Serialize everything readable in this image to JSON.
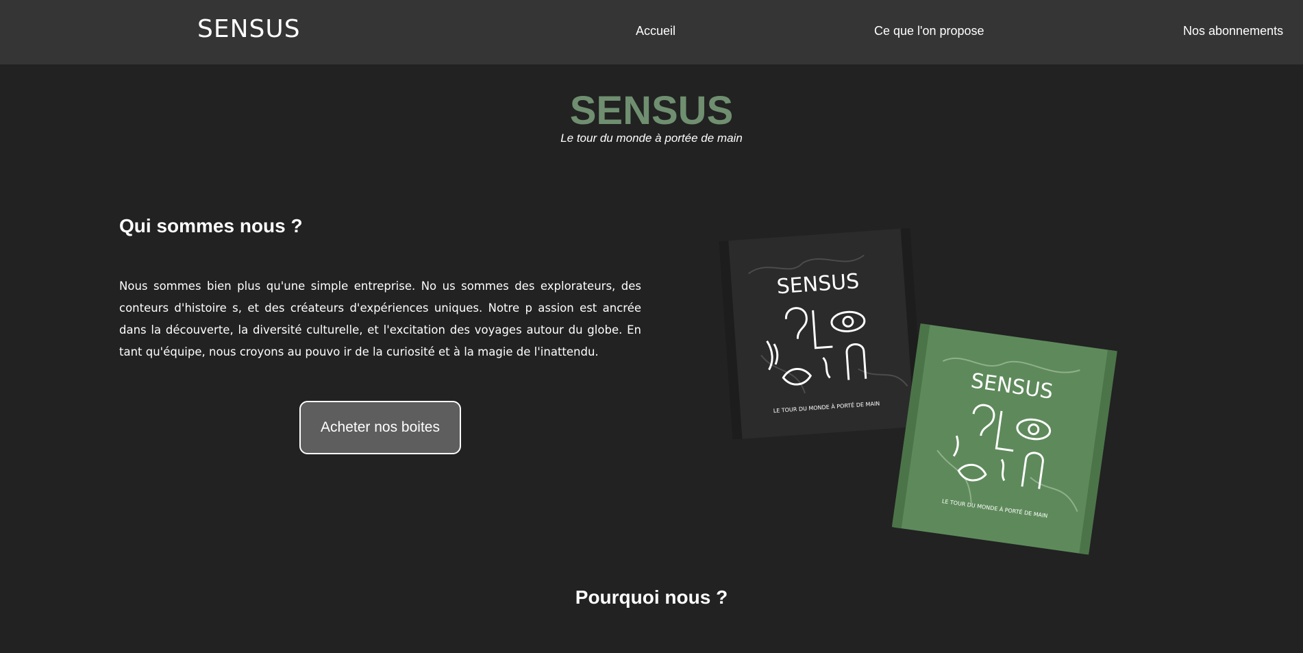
{
  "nav": {
    "logo": "SENSUS",
    "links": [
      {
        "label": "Accueil"
      },
      {
        "label": "Ce que l'on propose"
      },
      {
        "label": "Nos abonnements"
      }
    ]
  },
  "hero": {
    "title": "SENSUS",
    "tagline": "Le tour du monde à portée de main"
  },
  "about": {
    "heading": "Qui sommes nous ?",
    "text": "Nous sommes bien plus qu'une simple entreprise. No us sommes des explorateurs, des conteurs d'histoire s, et des créateurs d'expériences uniques. Notre p assion est ancrée dans la découverte, la diversité culturelle, et l'excitation des voyages autour du globe. En tant qu'équipe, nous croyons au pouvo ir de la curiosité et à la magie de l'inattendu.",
    "button_label": "Acheter nos boites"
  },
  "product_image": {
    "box_brand": "SENSUS",
    "box_caption": "LE TOUR DU MONDE À PORTÉ DE MAIN",
    "colors": {
      "dark_box": "#2a2b2a",
      "green_box": "#5e8a5b"
    }
  },
  "why": {
    "heading": "Pourquoi nous ?"
  },
  "colors": {
    "background": "#222222",
    "navbar": "#353535",
    "accent_green": "#6f8f70",
    "button": "#5e5e5e"
  }
}
